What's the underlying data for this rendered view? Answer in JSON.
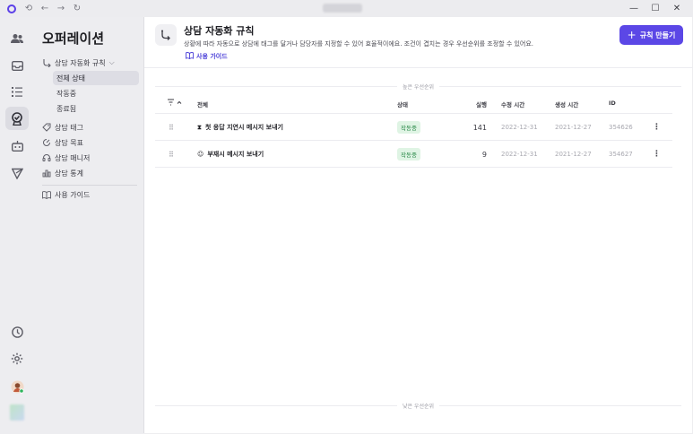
{
  "titlebar": {
    "nav": [
      "⟲",
      "←",
      "→",
      "↻"
    ],
    "window_controls": [
      "—",
      "☐",
      "✕"
    ]
  },
  "rail": {
    "icons": [
      "people-icon",
      "inbox-icon",
      "list-icon",
      "automation-icon",
      "bot-icon",
      "send-icon",
      "clock-icon",
      "settings-icon",
      "avatar"
    ]
  },
  "sidebar": {
    "title": "오퍼레이션",
    "group_label": "상담 자동화 규칙",
    "group_chevron": "⌵",
    "subitems": [
      "전체 상태",
      "작동중",
      "종료됨"
    ],
    "items": [
      "상담 태그",
      "상담 목표",
      "상담 매니저",
      "상담 통계"
    ],
    "guide": "사용 가이드"
  },
  "header": {
    "title": "상담 자동화 규칙",
    "description": "상황에 따라 자동으로 상담에 태그를 달거나 담당자를 지정할 수 있어 효율적이에요. 조건이 겹치는 경우 우선순위를 조정할 수 있어요.",
    "guide_link": "사용 가이드",
    "create_button": "규칙 만들기",
    "create_plus": "+"
  },
  "table": {
    "priority_high": "높은 우선순위",
    "priority_low": "낮은 우선순위",
    "headers": {
      "all": "전체",
      "status": "상태",
      "runs": "실행",
      "modified": "수정 시간",
      "created": "생성 시간",
      "id": "ID"
    },
    "rows": [
      {
        "icon": "⧗",
        "name": "첫 응답 지연시 메시지 보내기",
        "status": "작동중",
        "runs": "141",
        "modified": "2022-12-31",
        "created": "2021-12-27",
        "id": "354626",
        "more": "⋮"
      },
      {
        "icon": "☺",
        "name": "부재시 메시지 보내기",
        "status": "작동중",
        "runs": "9",
        "modified": "2022-12-31",
        "created": "2021-12-27",
        "id": "354627",
        "more": "⋮"
      }
    ]
  },
  "colors": {
    "accent": "#5b47e6",
    "status_bg": "#dff4e4",
    "status_text": "#2c8a4a"
  }
}
